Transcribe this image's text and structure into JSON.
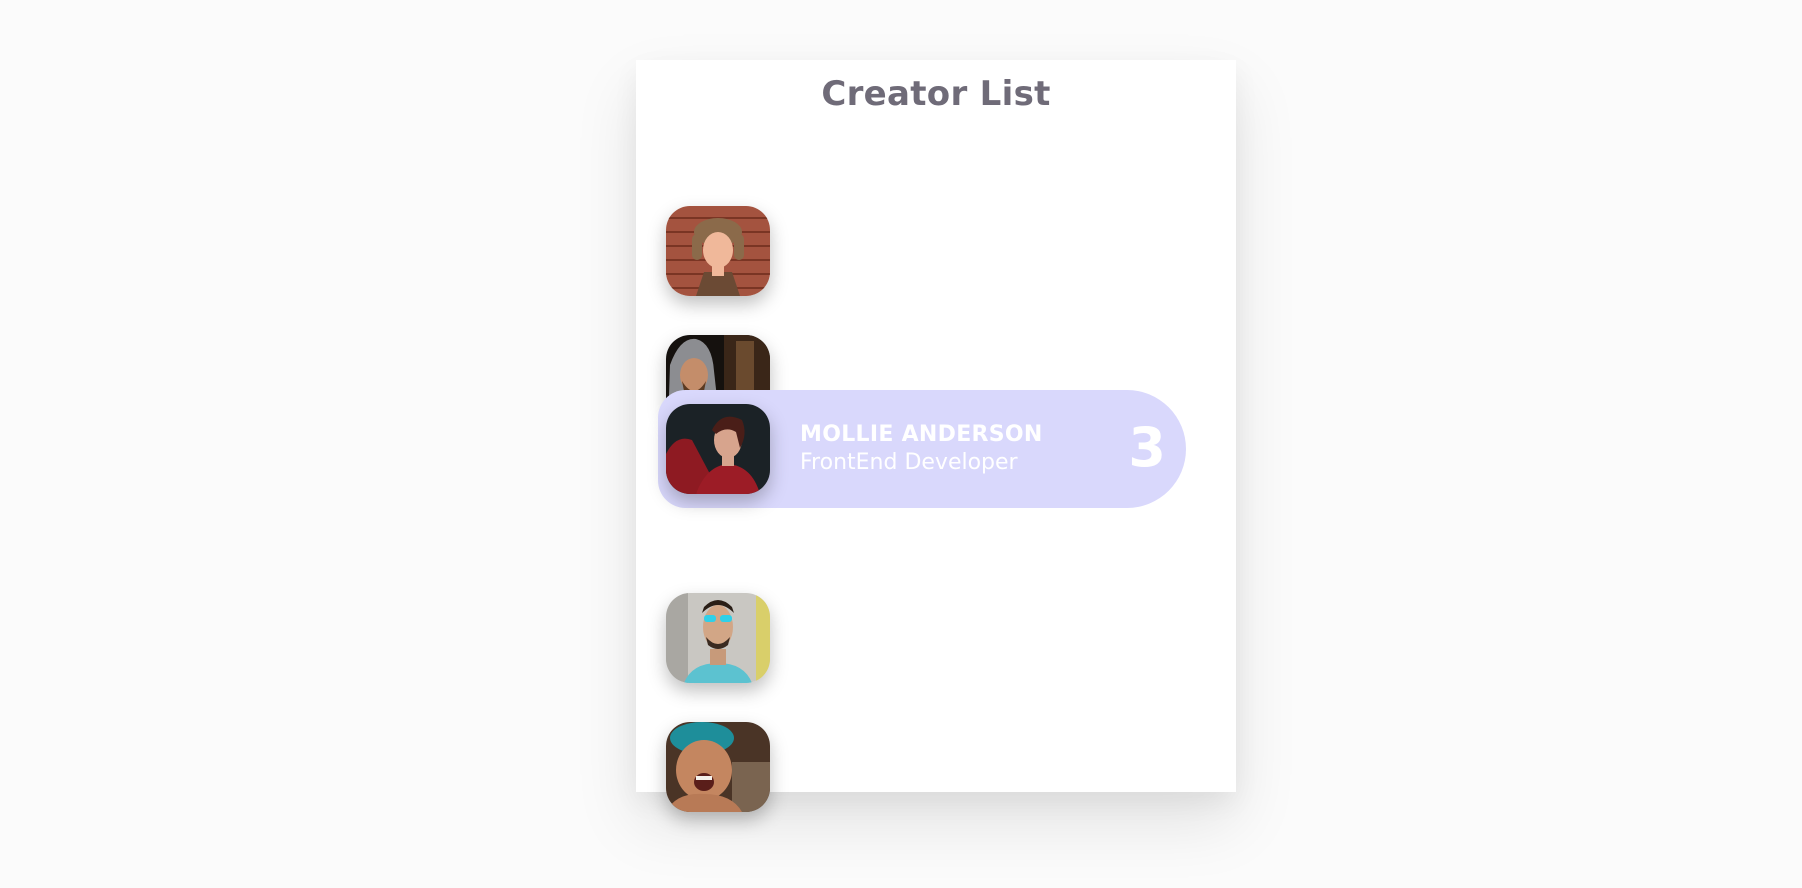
{
  "header": {
    "title": "Creator List"
  },
  "creators": [
    {
      "avatar": "avatar-man-fur-hat",
      "name": "",
      "role": "",
      "rank": "",
      "active": false
    },
    {
      "avatar": "avatar-man-hood-beard",
      "name": "",
      "role": "",
      "rank": "",
      "active": false
    },
    {
      "avatar": "avatar-woman-red-sweater",
      "name": "MOLLIE ANDERSON",
      "role": "FrontEnd Developer",
      "rank": "3",
      "active": true
    },
    {
      "avatar": "avatar-man-sunglasses",
      "name": "",
      "role": "",
      "rank": "",
      "active": false
    },
    {
      "avatar": "avatar-woman-blue-hair",
      "name": "",
      "role": "",
      "rank": "",
      "active": false
    }
  ],
  "colors": {
    "active_row": "#d9d8fc",
    "title": "#6f6b78",
    "background": "#fbfbfb"
  }
}
